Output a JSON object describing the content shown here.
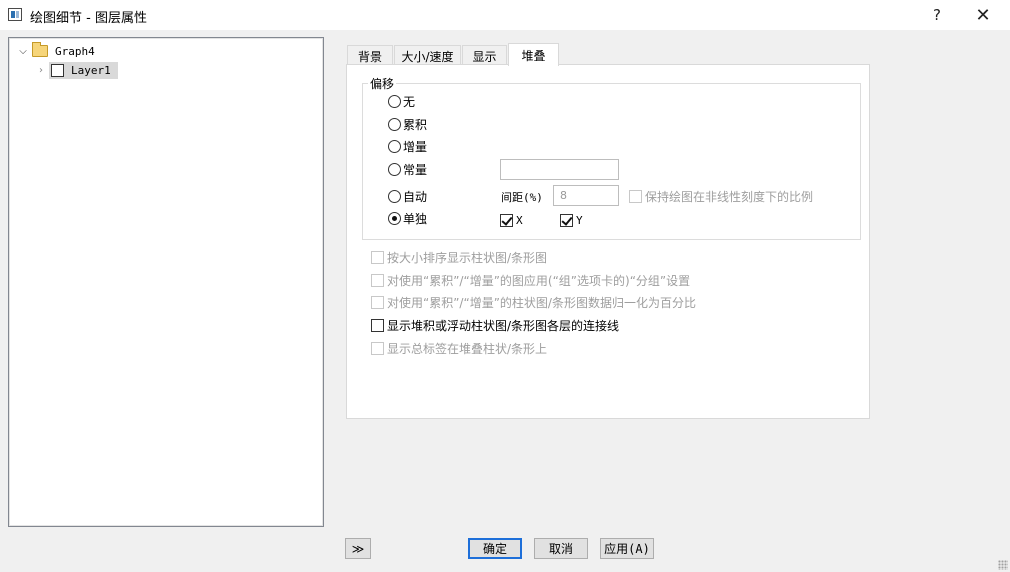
{
  "window": {
    "title": "绘图细节 - 图层属性",
    "help_label": "?",
    "close_label": "✕"
  },
  "tree": {
    "root": {
      "label": "Graph4",
      "expanded": true
    },
    "child": {
      "label": "Layer1",
      "selected": true
    }
  },
  "tabs": [
    {
      "label": "背景",
      "active": false
    },
    {
      "label": "大小/速度",
      "active": false
    },
    {
      "label": "显示",
      "active": false
    },
    {
      "label": "堆叠",
      "active": true
    }
  ],
  "offset_group": {
    "title": "偏移",
    "options": [
      {
        "label": "无",
        "checked": false
      },
      {
        "label": "累积",
        "checked": false
      },
      {
        "label": "增量",
        "checked": false
      },
      {
        "label": "常量",
        "checked": false
      },
      {
        "label": "自动",
        "checked": false
      },
      {
        "label": "单独",
        "checked": true
      }
    ],
    "constant_value": "",
    "gap_label": "间距(%)",
    "gap_value": "8",
    "keep_ratio_label": "保持绘图在非线性刻度下的比例",
    "keep_ratio_checked": false,
    "x_label": "X",
    "x_checked": true,
    "y_label": "Y",
    "y_checked": true
  },
  "options": [
    {
      "label": "按大小排序显示柱状图/条形图",
      "checked": false,
      "enabled": false
    },
    {
      "label": "对使用“累积”/“增量”的图应用(“组”选项卡的)“分组”设置",
      "checked": false,
      "enabled": false
    },
    {
      "label": "对使用“累积”/“增量”的柱状图/条形图数据归一化为百分比",
      "checked": false,
      "enabled": false
    },
    {
      "label": "显示堆积或浮动柱状图/条形图各层的连接线",
      "checked": false,
      "enabled": true
    },
    {
      "label": "显示总标签在堆叠柱状/条形上",
      "checked": false,
      "enabled": false
    }
  ],
  "buttons": {
    "expand": "≫",
    "ok": "确定",
    "cancel": "取消",
    "apply": "应用(A)"
  }
}
